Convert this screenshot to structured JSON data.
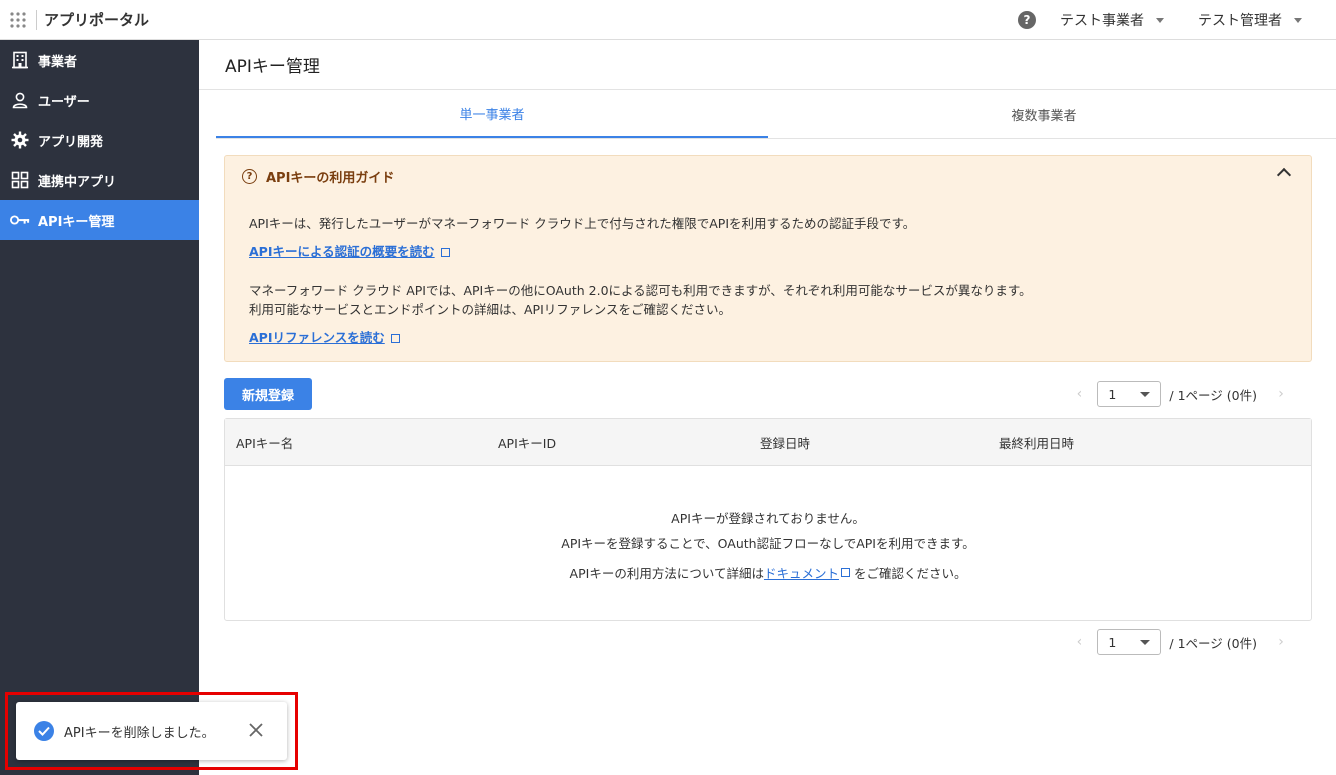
{
  "header": {
    "brand": "アプリポータル",
    "help": "?",
    "office_dropdown": "テスト事業者",
    "user_dropdown": "テスト管理者"
  },
  "sidebar": {
    "items": [
      {
        "label": "事業者",
        "icon": "building-icon"
      },
      {
        "label": "ユーザー",
        "icon": "user-icon"
      },
      {
        "label": "アプリ開発",
        "icon": "gear-icon"
      },
      {
        "label": "連携中アプリ",
        "icon": "apps-grid-icon"
      },
      {
        "label": "APIキー管理",
        "icon": "key-icon",
        "active": true
      }
    ]
  },
  "page": {
    "title": "APIキー管理",
    "tabs": [
      {
        "label": "単一事業者",
        "active": true
      },
      {
        "label": "複数事業者",
        "active": false
      }
    ]
  },
  "guide": {
    "title": "APIキーの利用ガイド",
    "p1": "APIキーは、発行したユーザーがマネーフォワード クラウド上で付与された権限でAPIを利用するための認証手段です。",
    "link1": "APIキーによる認証の概要を読む",
    "p2": "マネーフォワード クラウド APIでは、APIキーの他にOAuth 2.0による認可も利用できますが、それぞれ利用可能なサービスが異なります。",
    "p3": "利用可能なサービスとエンドポイントの詳細は、APIリファレンスをご確認ください。",
    "link2": "APIリファレンスを読む"
  },
  "actions": {
    "new_button": "新規登録"
  },
  "pagination": {
    "prev": "‹",
    "next": "›",
    "page": "1",
    "info": "/ 1ページ (0件)"
  },
  "table": {
    "columns": [
      "APIキー名",
      "APIキーID",
      "登録日時",
      "最終利用日時"
    ],
    "empty": {
      "line1": "APIキーが登録されておりません。",
      "line2": "APIキーを登録することで、OAuth認証フローなしでAPIを利用できます。",
      "line3_pre": "APIキーの利用方法について詳細は",
      "line3_link": "ドキュメント",
      "line3_post": " をご確認ください。"
    }
  },
  "toast": {
    "message": "APIキーを削除しました。"
  },
  "colors": {
    "accent": "#3b82e6",
    "sidebar": "#2d323e",
    "guide_bg": "#fdf1e1",
    "guide_title": "#7a3e0f",
    "highlight": "#e60000"
  }
}
